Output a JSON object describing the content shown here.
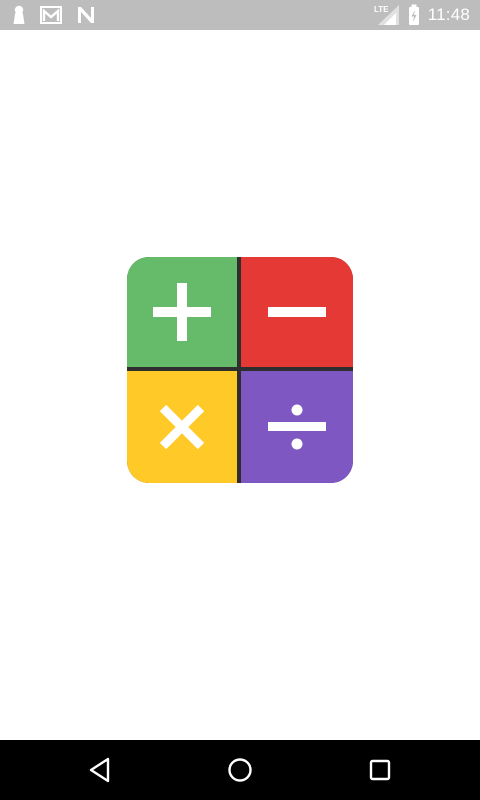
{
  "status_bar": {
    "time": "11:48",
    "network_label": "LTE",
    "left_icons": [
      "keyhole-notification-icon",
      "gmail-icon",
      "n-app-icon"
    ],
    "right_icons": [
      "lte-signal-icon",
      "battery-charging-icon"
    ]
  },
  "app_logo": {
    "tiles": [
      {
        "symbol": "plus",
        "color": "#66BB6A"
      },
      {
        "symbol": "minus",
        "color": "#E53935"
      },
      {
        "symbol": "times",
        "color": "#FFCA28"
      },
      {
        "symbol": "divide",
        "color": "#7E57C2"
      }
    ],
    "divider_color": "#2E2E2E"
  },
  "nav_bar": {
    "buttons": [
      "back",
      "home",
      "recents"
    ]
  }
}
